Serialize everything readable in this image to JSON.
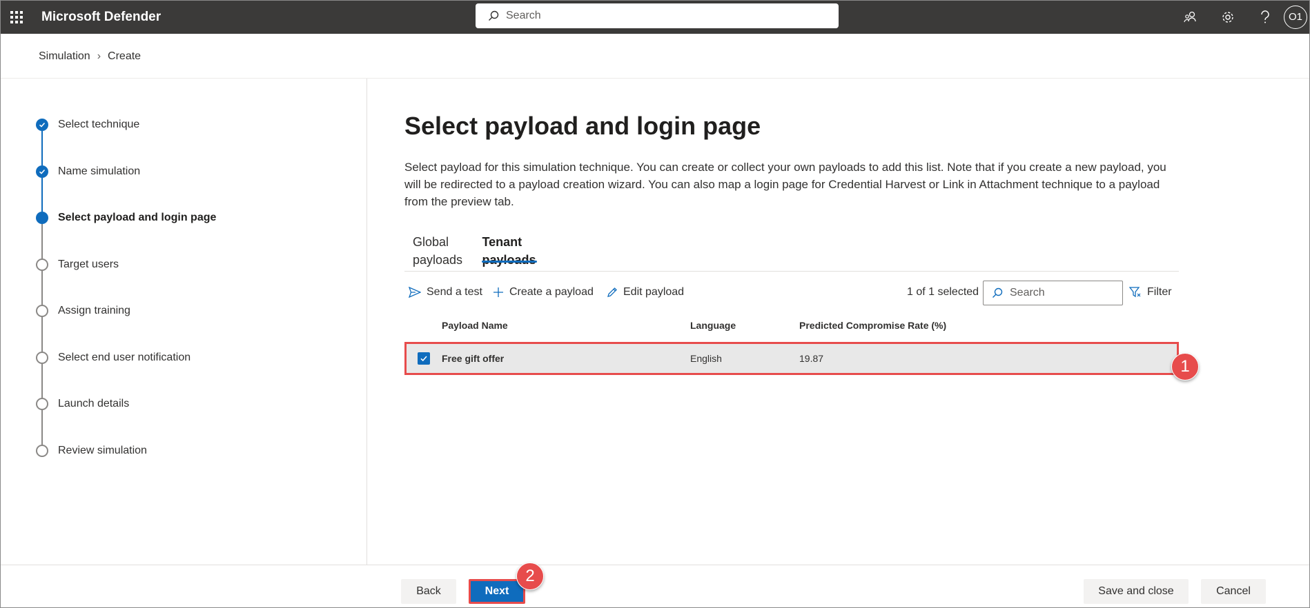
{
  "app": {
    "title": "Microsoft Defender"
  },
  "topbar": {
    "search_placeholder": "Search",
    "icons": [
      "community-icon",
      "gear-icon",
      "help-icon"
    ],
    "avatar_initials": "O1"
  },
  "breadcrumb": {
    "items": [
      "Simulation",
      "Create"
    ]
  },
  "steps": [
    {
      "label": "Select technique",
      "state": "done"
    },
    {
      "label": "Name simulation",
      "state": "done"
    },
    {
      "label": "Select payload and login page",
      "state": "current"
    },
    {
      "label": "Target users",
      "state": "todo"
    },
    {
      "label": "Assign training",
      "state": "todo"
    },
    {
      "label": "Select end user notification",
      "state": "todo"
    },
    {
      "label": "Launch details",
      "state": "todo"
    },
    {
      "label": "Review simulation",
      "state": "todo"
    }
  ],
  "main": {
    "title": "Select payload and login page",
    "description": "Select payload for this simulation technique. You can create or collect your own payloads to add this list. Note that if you create a new payload, you will be redirected to a payload creation wizard. You can also map a login page for Credential Harvest or Link in Attachment technique to a payload from the preview tab.",
    "tabs": [
      {
        "label": "Global payloads",
        "active": false
      },
      {
        "label": "Tenant payloads",
        "active": true
      }
    ],
    "commands": {
      "send_test": "Send a test",
      "create_payload": "Create a payload",
      "edit_payload": "Edit payload"
    },
    "selected_count": "1 of 1 selected",
    "search_placeholder": "Search",
    "filter_label": "Filter",
    "table": {
      "headers": [
        "Payload Name",
        "Language",
        "Predicted Compromise Rate (%)"
      ],
      "rows": [
        {
          "name": "Free gift offer",
          "language": "English",
          "rate": "19.87",
          "checked": true
        }
      ]
    }
  },
  "annotations": {
    "badge1": "1",
    "badge2": "2",
    "color": "#e74c4c"
  },
  "footer": {
    "back": "Back",
    "next": "Next",
    "save_close": "Save and close",
    "cancel": "Cancel"
  },
  "colors": {
    "accent": "#0f6cbd",
    "topbar": "#3b3a39"
  }
}
